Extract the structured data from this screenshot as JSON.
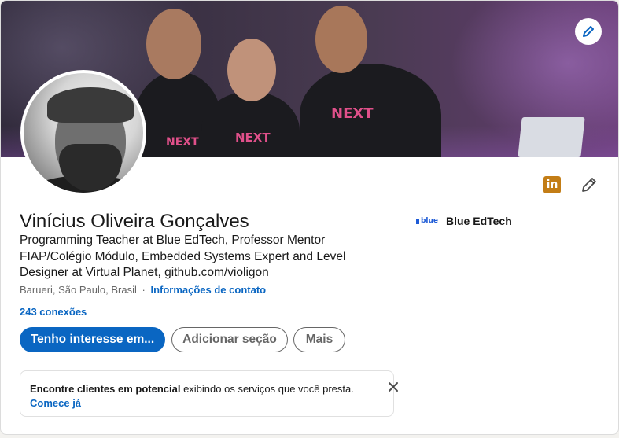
{
  "profile": {
    "name": "Vinícius Oliveira Gonçalves",
    "headline": "Programming Teacher at Blue EdTech, Professor Mentor FIAP/Colégio Módulo, Embedded Systems Expert and Level Designer at Virtual Planet, github.com/violigon",
    "location": "Barueri, São Paulo, Brasil",
    "separator": "·",
    "contact_link": "Informações de contato",
    "connections": "243 conexões"
  },
  "banner": {
    "shirt_text": "NEXT",
    "edit_icon": "pencil-icon"
  },
  "company": {
    "logo_text": "blue",
    "name": "Blue EdTech",
    "logo_color": "#1e5bd6"
  },
  "actions": {
    "primary": "Tenho interesse em...",
    "add_section": "Adicionar seção",
    "more": "Mais"
  },
  "promo": {
    "bold": "Encontre clientes em potencial",
    "rest": " exibindo os serviços que você presta.",
    "cta": "Comece já",
    "close_icon": "close-icon"
  },
  "colors": {
    "accent": "#0a66c2",
    "linkedin_badge": "#c37d16"
  }
}
